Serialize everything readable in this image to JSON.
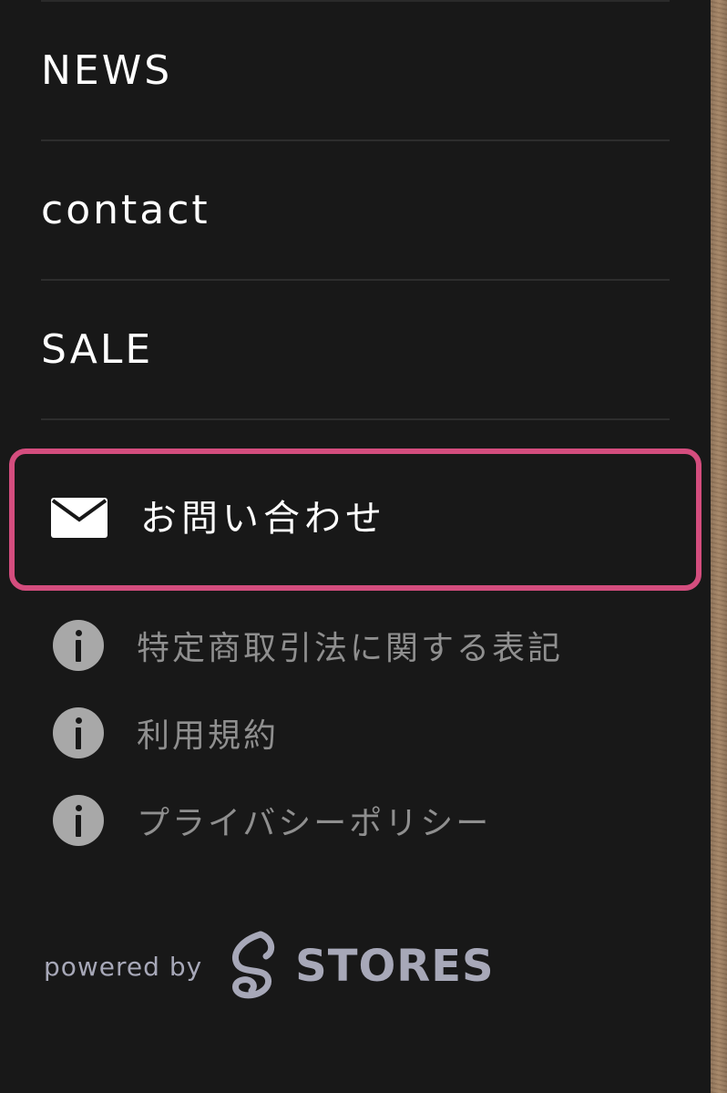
{
  "nav": {
    "items": [
      {
        "label": "NEWS"
      },
      {
        "label": "contact"
      },
      {
        "label": "SALE"
      }
    ]
  },
  "contact": {
    "label": "お問い合わせ",
    "icon": "mail-icon",
    "highlight_color": "#d44d7e"
  },
  "links": {
    "items": [
      {
        "label": "特定商取引法に関する表記",
        "icon": "info-icon"
      },
      {
        "label": "利用規約",
        "icon": "info-icon"
      },
      {
        "label": "プライバシーポリシー",
        "icon": "info-icon"
      }
    ]
  },
  "footer": {
    "powered_by": "powered by",
    "brand": "STORES",
    "brand_icon": "stores-logo-icon"
  }
}
